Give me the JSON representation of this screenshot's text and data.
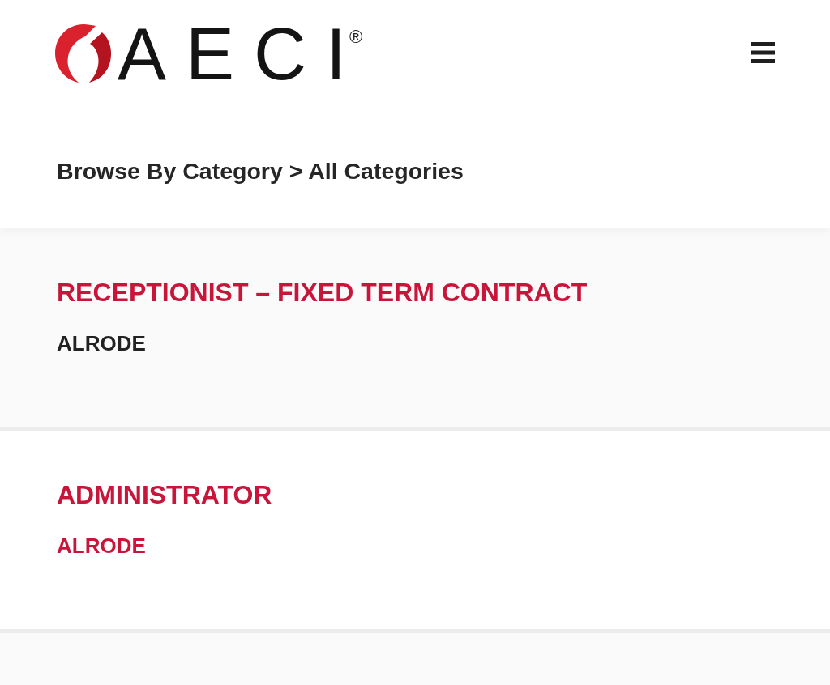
{
  "header": {
    "logo": {
      "wordmark": "AECI$^{®}$"
    }
  },
  "page_title": "Browse By Category > All Categories",
  "jobs": [
    {
      "title": "RECEPTIONIST – FIXED TERM CONTRACT",
      "location": "ALRODE",
      "highlighted": true
    },
    {
      "title": "ADMINISTRATOR",
      "location": "ALRODE",
      "highlighted": false
    }
  ]
}
